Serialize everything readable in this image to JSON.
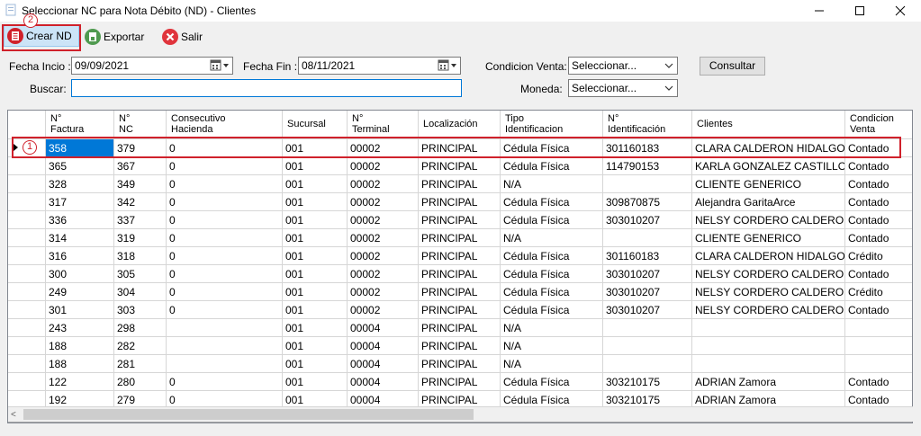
{
  "window": {
    "title": "Seleccionar NC para Nota Débito (ND) - Clientes",
    "minimize_label": "–",
    "maximize_label": "☐",
    "close_label": "✕"
  },
  "toolbar": {
    "crear_label": "Crear ND",
    "exportar_label": "Exportar",
    "salir_label": "Salir",
    "annotation_badge": "2"
  },
  "filters": {
    "fecha_inicio_label": "Fecha Incio :",
    "fecha_inicio_value": "09/09/2021",
    "fecha_fin_label": "Fecha Fin :",
    "fecha_fin_value": "08/11/2021",
    "condicion_label": "Condicion Venta:",
    "condicion_value": "Seleccionar...",
    "moneda_label": "Moneda:",
    "moneda_value": "Seleccionar...",
    "buscar_label": "Buscar:",
    "buscar_value": "",
    "consultar_label": "Consultar"
  },
  "grid": {
    "annotation_badge": "1",
    "columns": [
      {
        "l1": "N°",
        "l2": "Factura"
      },
      {
        "l1": "N°",
        "l2": "NC"
      },
      {
        "l1": "Consecutivo",
        "l2": "Hacienda"
      },
      {
        "l1": "Sucursal",
        "l2": ""
      },
      {
        "l1": "N°",
        "l2": "Terminal"
      },
      {
        "l1": "Localización",
        "l2": ""
      },
      {
        "l1": "Tipo",
        "l2": "Identificacion"
      },
      {
        "l1": "N°",
        "l2": "Identificación"
      },
      {
        "l1": "Clientes",
        "l2": ""
      },
      {
        "l1": "Condicion",
        "l2": "Venta"
      }
    ],
    "rows": [
      [
        "358",
        "379",
        "0",
        "001",
        "00002",
        "PRINCIPAL",
        "Cédula Física",
        "301160183",
        "CLARA CALDERON HIDALGO",
        "Contado"
      ],
      [
        "365",
        "367",
        "0",
        "001",
        "00002",
        "PRINCIPAL",
        "Cédula Física",
        "114790153",
        "KARLA GONZALEZ CASTILLO",
        "Contado"
      ],
      [
        "328",
        "349",
        "0",
        "001",
        "00002",
        "PRINCIPAL",
        "N/A",
        "",
        "CLIENTE GENERICO",
        "Contado"
      ],
      [
        "317",
        "342",
        "0",
        "001",
        "00002",
        "PRINCIPAL",
        "Cédula Física",
        "309870875",
        "Alejandra GaritaArce",
        "Contado"
      ],
      [
        "336",
        "337",
        "0",
        "001",
        "00002",
        "PRINCIPAL",
        "Cédula Física",
        "303010207",
        "NELSY CORDERO CALDERON",
        "Contado"
      ],
      [
        "314",
        "319",
        "0",
        "001",
        "00002",
        "PRINCIPAL",
        "N/A",
        "",
        "CLIENTE GENERICO",
        "Contado"
      ],
      [
        "316",
        "318",
        "0",
        "001",
        "00002",
        "PRINCIPAL",
        "Cédula Física",
        "301160183",
        "CLARA CALDERON HIDALGO",
        "Crédito"
      ],
      [
        "300",
        "305",
        "0",
        "001",
        "00002",
        "PRINCIPAL",
        "Cédula Física",
        "303010207",
        "NELSY CORDERO CALDERON",
        "Contado"
      ],
      [
        "249",
        "304",
        "0",
        "001",
        "00002",
        "PRINCIPAL",
        "Cédula Física",
        "303010207",
        "NELSY CORDERO CALDERON",
        "Crédito"
      ],
      [
        "301",
        "303",
        "0",
        "001",
        "00002",
        "PRINCIPAL",
        "Cédula Física",
        "303010207",
        "NELSY CORDERO CALDERON",
        "Contado"
      ],
      [
        "243",
        "298",
        "",
        "001",
        "00004",
        "PRINCIPAL",
        "N/A",
        "",
        "",
        ""
      ],
      [
        "188",
        "282",
        "",
        "001",
        "00004",
        "PRINCIPAL",
        "N/A",
        "",
        "",
        ""
      ],
      [
        "188",
        "281",
        "",
        "001",
        "00004",
        "PRINCIPAL",
        "N/A",
        "",
        "",
        ""
      ],
      [
        "122",
        "280",
        "0",
        "001",
        "00004",
        "PRINCIPAL",
        "Cédula Física",
        "303210175",
        "ADRIAN Zamora",
        "Contado"
      ],
      [
        "192",
        "279",
        "0",
        "001",
        "00004",
        "PRINCIPAL",
        "Cédula Física",
        "303210175",
        "ADRIAN Zamora",
        "Contado"
      ]
    ]
  },
  "scrollbar": {
    "left_arrow": "<"
  }
}
